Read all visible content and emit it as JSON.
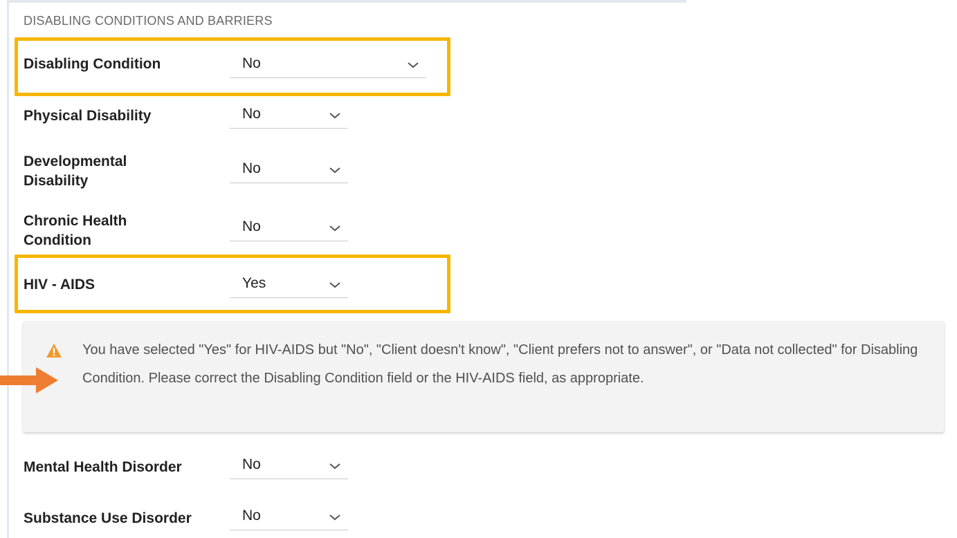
{
  "section": {
    "title": "DISABLING CONDITIONS AND BARRIERS"
  },
  "fields": [
    {
      "label": "Disabling Condition",
      "value": "No"
    },
    {
      "label": "Physical Disability",
      "value": "No"
    },
    {
      "label": "Developmental Disability",
      "value": "No"
    },
    {
      "label": "Chronic Health Condition",
      "value": "No"
    },
    {
      "label": "HIV - AIDS",
      "value": "Yes"
    },
    {
      "label": "Mental Health Disorder",
      "value": "No"
    },
    {
      "label": "Substance Use Disorder",
      "value": "No"
    }
  ],
  "warning": {
    "text": "You have selected \"Yes\" for HIV-AIDS but \"No\", \"Client doesn't know\", \"Client prefers not to answer\", or \"Data not collected\" for Disabling Condition. Please correct the Disabling Condition field or the HIV-AIDS field, as appropriate.",
    "icon": "warning-triangle-icon"
  },
  "annotations": {
    "highlight_color": "#f6b600",
    "arrow_color": "#ee7d32",
    "warning_icon_color": "#f29a2e"
  },
  "icons": {
    "dropdown": "chevron-down-icon"
  }
}
